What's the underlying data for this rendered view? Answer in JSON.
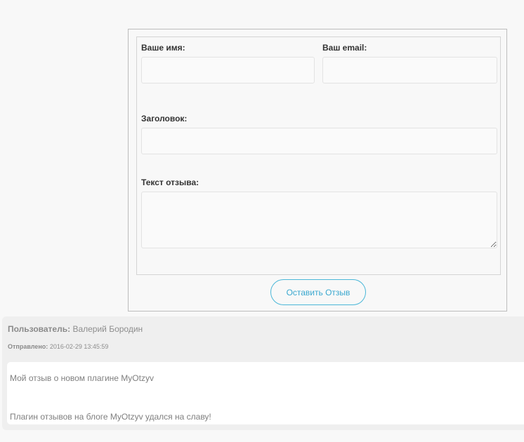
{
  "form": {
    "name_label": "Ваше имя:",
    "name_value": "",
    "email_label": "Ваш email:",
    "email_value": "",
    "title_label": "Заголовок:",
    "title_value": "",
    "text_label": "Текст отзыва:",
    "text_value": "",
    "submit_label": "Оставить Отзыв"
  },
  "review": {
    "user_label": "Пользователь:",
    "user_name": "Валерий Бородин",
    "sent_label": "Отправлено:",
    "sent_date": "2016-02-29 13:45:59",
    "title": "Мой отзыв о новом плагине MyOtzyv",
    "text": "Плагин отзывов на блоге MyOtzyv удался на славу!"
  },
  "colors": {
    "accent": "#3aa8cf",
    "page_background": "#f8f8f8",
    "review_background": "#efefef"
  }
}
